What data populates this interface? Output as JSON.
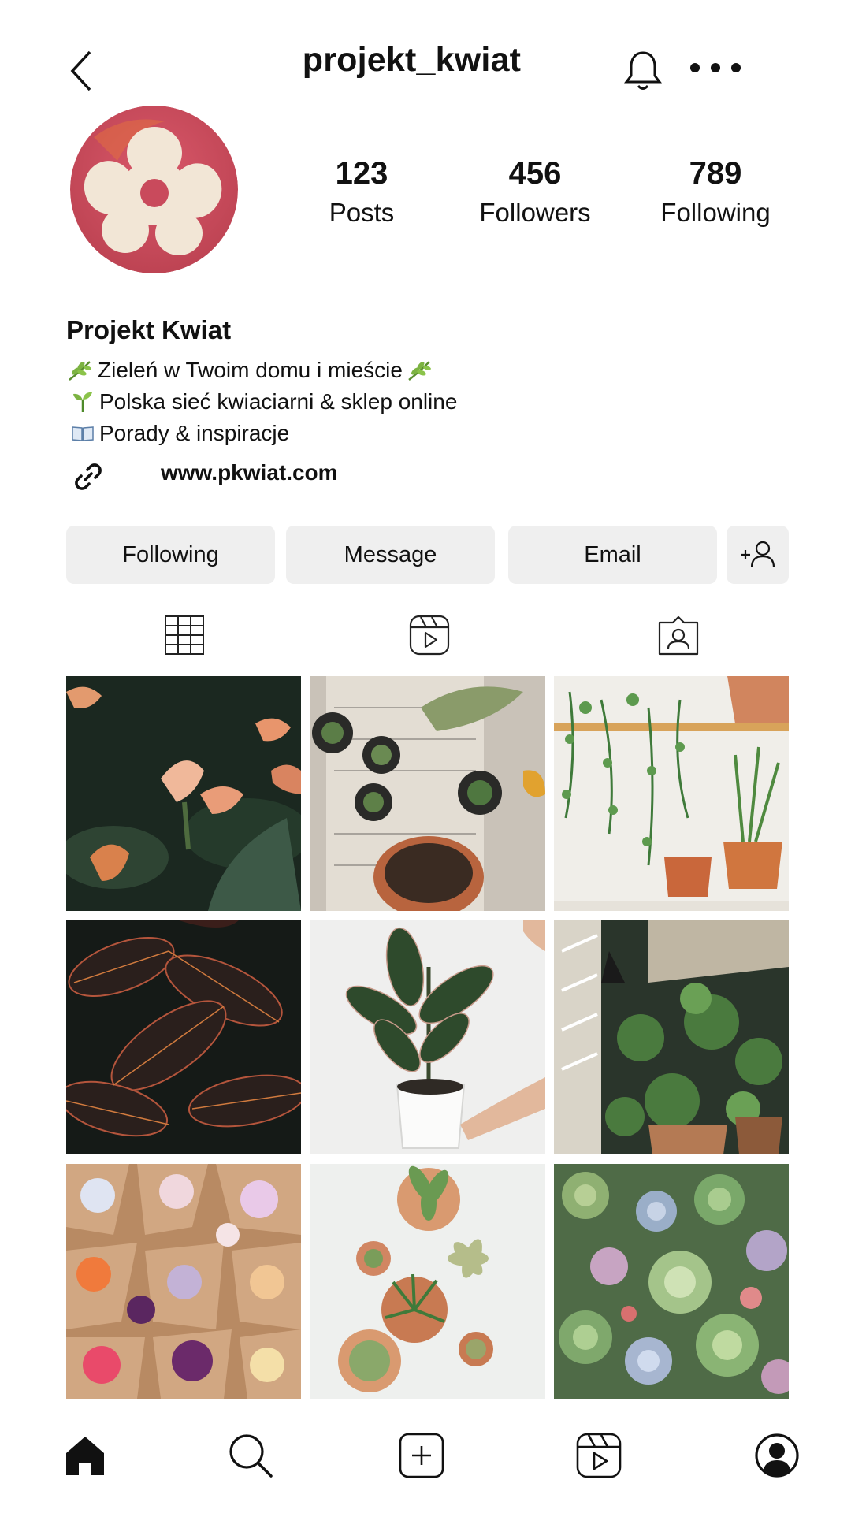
{
  "header": {
    "username": "projekt_kwiat",
    "icons": {
      "back": "chevron-left-icon",
      "notifications": "bell-icon",
      "more": "more-horizontal-icon"
    }
  },
  "profile": {
    "avatar_colors": {
      "background": "#cc4a5a",
      "flower": "#f2e6d6"
    },
    "stats": [
      {
        "value": "123",
        "label": "Posts"
      },
      {
        "value": "456",
        "label": "Followers"
      },
      {
        "value": "789",
        "label": "Following"
      }
    ],
    "name": "Projekt Kwiat",
    "bio": [
      {
        "icon": "herb-emoji",
        "text": "Zieleń w Twoim domu i mieście",
        "trailing_icon": "herb-emoji"
      },
      {
        "icon": "seedling-emoji",
        "text": "Polska sieć kwiaciarni & sklep online"
      },
      {
        "icon": "open-book-emoji",
        "text": "Porady & inspiracje"
      }
    ],
    "website": "www.pkwiat.com"
  },
  "actions": {
    "following": "Following",
    "message": "Message",
    "email": "Email",
    "add_person_icon": "add-person-icon"
  },
  "tabs": [
    {
      "icon": "grid-icon"
    },
    {
      "icon": "reels-icon"
    },
    {
      "icon": "tagged-icon"
    }
  ],
  "posts": [
    {
      "subject": "calla lilies",
      "colors": [
        "#1d2a22",
        "#e89a7a"
      ]
    },
    {
      "subject": "succulents on newspaper",
      "colors": [
        "#cfc9c0",
        "#b86d45"
      ]
    },
    {
      "subject": "hanging plants shelf",
      "colors": [
        "#eeece6",
        "#3e7a3c"
      ]
    },
    {
      "subject": "croton leaves",
      "colors": [
        "#1a1f1c",
        "#b0543d"
      ]
    },
    {
      "subject": "rubber plant in white pot",
      "colors": [
        "#f1f1f0",
        "#2f4a2e"
      ]
    },
    {
      "subject": "plant shop interior",
      "colors": [
        "#2c3a2e",
        "#c8c0b0"
      ]
    },
    {
      "subject": "wrapped bouquets",
      "colors": [
        "#c99a74",
        "#7a3a7a"
      ]
    },
    {
      "subject": "potted succulents on white",
      "colors": [
        "#eef0ee",
        "#d29a72"
      ]
    },
    {
      "subject": "succulent garden",
      "colors": [
        "#5c7a52",
        "#a9b8c8"
      ]
    }
  ],
  "bottom_nav": [
    {
      "icon": "home-icon"
    },
    {
      "icon": "search-icon"
    },
    {
      "icon": "create-post-icon"
    },
    {
      "icon": "reels-icon"
    },
    {
      "icon": "profile-icon"
    }
  ]
}
